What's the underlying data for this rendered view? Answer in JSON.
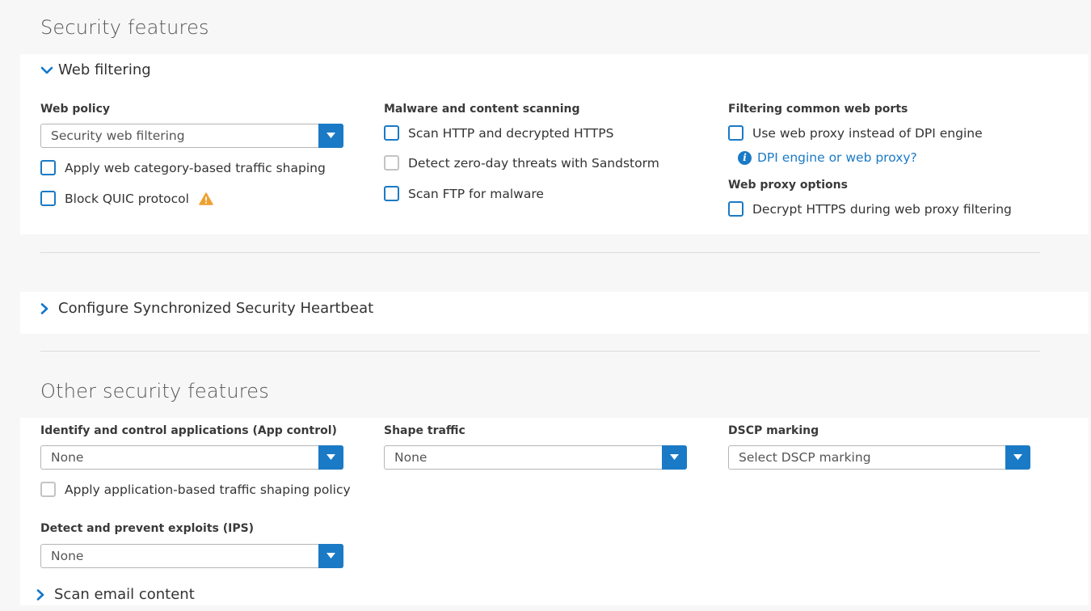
{
  "security_features": {
    "title": "Security features",
    "web_filtering": {
      "title": "Web filtering",
      "web_policy": {
        "label": "Web policy",
        "value": "Security web filtering",
        "apply_shaping": "Apply web category-based traffic shaping",
        "block_quic": "Block QUIC protocol"
      },
      "malware": {
        "label": "Malware and content scanning",
        "scan_http": "Scan HTTP and decrypted HTTPS",
        "sandstorm": "Detect zero-day threats with Sandstorm",
        "scan_ftp": "Scan FTP for malware"
      },
      "ports": {
        "label": "Filtering common web ports",
        "use_proxy": "Use web proxy instead of DPI engine",
        "help_link": "DPI engine or web proxy?"
      },
      "proxy_options": {
        "label": "Web proxy options",
        "decrypt": "Decrypt HTTPS during web proxy filtering"
      }
    },
    "heartbeat": {
      "title": "Configure Synchronized Security Heartbeat"
    }
  },
  "other": {
    "title": "Other security features",
    "app_control": {
      "label": "Identify and control applications (App control)",
      "value": "None",
      "apply_shaping": "Apply application-based traffic shaping policy"
    },
    "shape_traffic": {
      "label": "Shape traffic",
      "value": "None"
    },
    "dscp": {
      "label": "DSCP marking",
      "placeholder": "Select DSCP marking"
    },
    "ips": {
      "label": "Detect and prevent exploits (IPS)",
      "value": "None"
    },
    "scan_email": {
      "title": "Scan email content"
    }
  },
  "colors": {
    "accent": "#1a7ac6",
    "warning": "#f0a030"
  },
  "icons": {
    "expanded": "chevron-down-icon",
    "collapsed": "chevron-right-icon",
    "dropdown": "caret-down-icon",
    "warning": "warning-icon",
    "info": "info-icon"
  }
}
